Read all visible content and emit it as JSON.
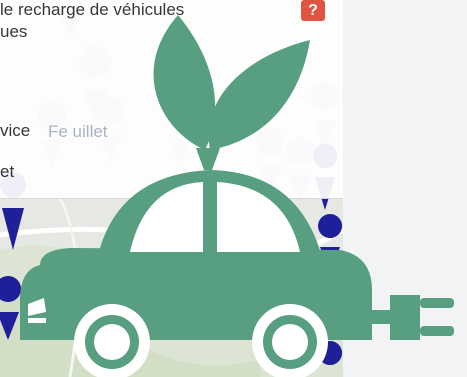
{
  "panel": {
    "title_line1": "le recharge de véhicules",
    "title_line2": "ues",
    "item_1": "vice",
    "item_2": "et",
    "help_label": "?"
  },
  "map": {
    "place_label": "Fe  uillet"
  },
  "colors": {
    "logo_green": "#589e80",
    "marker_lavender": "#b7b9dc",
    "marker_blue": "#1f1f9a",
    "help_red": "#e04a35",
    "background": "#f2f3f5"
  },
  "icons": [
    "help-icon",
    "map-marker-icon",
    "leaf-icon",
    "electric-car-icon",
    "plug-icon"
  ]
}
